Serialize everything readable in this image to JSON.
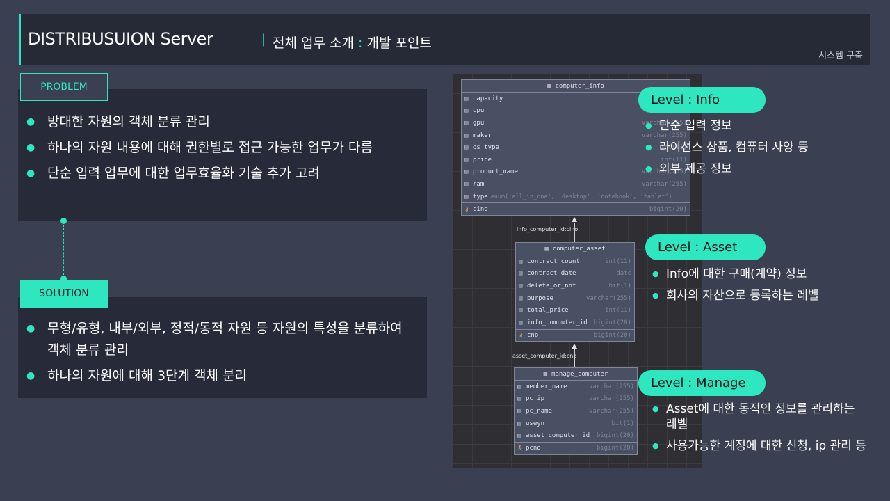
{
  "header": {
    "title": "DISTRIBUSUION Server",
    "separator": "|",
    "subtitle_a": "전체 업무 소개",
    "subtitle_colon": ":",
    "subtitle_b": "개발 포인트",
    "breadcrumb": "시스템  구축"
  },
  "problem": {
    "tag": "PROBLEM",
    "bullets": [
      "방대한 자원의 객체 분류 관리",
      "하나의 자원 내용에 대해 권한별로 접근 가능한 업무가 다름",
      "단순 입력 업무에 대한 업무효율화 기술 추가 고려"
    ]
  },
  "solution": {
    "tag": "SOLUTION",
    "bullets": [
      "무형/유형, 내부/외부, 정적/동적 자원 등 자원의 특성을 분류하여 객체 분류 관리",
      "하나의 자원에 대해 3단계 객체 분리"
    ]
  },
  "diagram": {
    "tables": [
      {
        "name": "computer_info",
        "columns": [
          {
            "name": "capacity",
            "type": ""
          },
          {
            "name": "cpu",
            "type": ""
          },
          {
            "name": "gpu",
            "type": "varchar(255)"
          },
          {
            "name": "maker",
            "type": "varchar(255)"
          },
          {
            "name": "os_type",
            "type": "int(11)"
          },
          {
            "name": "price",
            "type": "int(11)"
          },
          {
            "name": "product_name",
            "type": "varchar(255)"
          },
          {
            "name": "ram",
            "type": "varchar(255)"
          },
          {
            "name": "type",
            "type": "enum('all_in_one', 'desktop', 'notebook', 'tablet')"
          }
        ],
        "key": {
          "name": "cino",
          "type": "bigint(20)"
        }
      },
      {
        "name": "computer_asset",
        "columns": [
          {
            "name": "contract_count",
            "type": "int(11)"
          },
          {
            "name": "contract_date",
            "type": "date"
          },
          {
            "name": "delete_or_not",
            "type": "bit(1)"
          },
          {
            "name": "purpose",
            "type": "varchar(255)"
          },
          {
            "name": "total_price",
            "type": "int(11)"
          },
          {
            "name": "info_computer_id",
            "type": "bigint(20)"
          }
        ],
        "key": {
          "name": "cno",
          "type": "bigint(20)"
        }
      },
      {
        "name": "manage_computer",
        "columns": [
          {
            "name": "member_name",
            "type": "varchar(255)"
          },
          {
            "name": "pc_ip",
            "type": "varchar(255)"
          },
          {
            "name": "pc_name",
            "type": "varchar(255)"
          },
          {
            "name": "useyn",
            "type": "bit(1)"
          },
          {
            "name": "asset_computer_id",
            "type": "bigint(20)"
          }
        ],
        "key": {
          "name": "pcno",
          "type": "bigint(20)"
        }
      }
    ],
    "fk_labels": [
      "info_computer_id:cino",
      "asset_computer_id:cno"
    ]
  },
  "levels": [
    {
      "badge": "Level : Info",
      "bullets": [
        "단순 입력 정보",
        "라이선스 상품, 컴퓨터 사양 등",
        "외부 제공 정보"
      ]
    },
    {
      "badge": "Level : Asset",
      "bullets": [
        "Info에 대한 구매(계약) 정보",
        "회사의 자산으로 등록하는 레벨"
      ]
    },
    {
      "badge": "Level : Manage",
      "bullets": [
        "Asset에 대한 동적인 정보를 관리하는 레벨",
        "사용가능한 계정에 대한 신청, ip 관리 등"
      ]
    }
  ],
  "icons": {
    "bullet": "bullet-dot-icon",
    "column": "column-icon",
    "key": "key-icon",
    "table": "table-icon"
  },
  "colors": {
    "accent": "#2ee6c0",
    "background": "#3a3f51",
    "panel": "#272b39"
  }
}
